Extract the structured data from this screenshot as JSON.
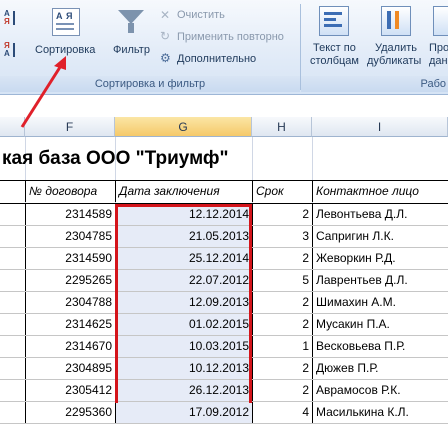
{
  "ribbon": {
    "sort_label": "Сортировка",
    "filter_label": "Фильтр",
    "clear_label": "Очистить",
    "reapply_label": "Применить повторно",
    "advanced_label": "Дополнительно",
    "sort_filter_group": "Сортировка и фильтр",
    "text_to_columns_line1": "Текст по",
    "text_to_columns_line2": "столбцам",
    "remove_dupes_line1": "Удалить",
    "remove_dupes_line2": "дубликаты",
    "partial_line1": "Про",
    "partial_line2": "дан",
    "data_tools_group": "Рабо",
    "sort_icon_a": "А",
    "sort_icon_ya": "Я",
    "sort_az_top": "А",
    "sort_az_bottom": "Я",
    "sort_za_top": "Я",
    "sort_za_bottom": "А"
  },
  "columns": [
    "F",
    "G",
    "H",
    "I"
  ],
  "sheet": {
    "title": "кая база ООО \"Триумф\"",
    "headers": {
      "contract": "№ договора",
      "date": "Дата заключения",
      "term": "Срок",
      "contact": "Контактное лицо"
    },
    "rows": [
      {
        "contract": "2314589",
        "date": "12.12.2014",
        "term": "2",
        "contact": "Левонтьева Д.Л."
      },
      {
        "contract": "2304785",
        "date": "21.05.2013",
        "term": "3",
        "contact": "Сапригин Л.К."
      },
      {
        "contract": "2314590",
        "date": "25.12.2014",
        "term": "2",
        "contact": "Жеворкин Р.Д."
      },
      {
        "contract": "2295265",
        "date": "22.07.2012",
        "term": "5",
        "contact": "Лаврентьев Д.Л."
      },
      {
        "contract": "2304788",
        "date": "12.09.2013",
        "term": "2",
        "contact": "Шимахин А.М."
      },
      {
        "contract": "2314625",
        "date": "01.02.2015",
        "term": "2",
        "contact": "Мусакин П.А."
      },
      {
        "contract": "2314670",
        "date": "10.03.2015",
        "term": "1",
        "contact": "Весковьева П.Р."
      },
      {
        "contract": "2304895",
        "date": "10.12.2013",
        "term": "2",
        "contact": "Дюжев П.Р."
      },
      {
        "contract": "2305412",
        "date": "26.12.2013",
        "term": "2",
        "contact": "Аврамосов Р.К."
      },
      {
        "contract": "2295360",
        "date": "17.09.2012",
        "term": "4",
        "contact": "Масилькина К.Л."
      }
    ]
  },
  "colors": {
    "highlight_box": "#d4141b",
    "arrow": "#e0202a",
    "selected_column": "#f5c96a"
  }
}
